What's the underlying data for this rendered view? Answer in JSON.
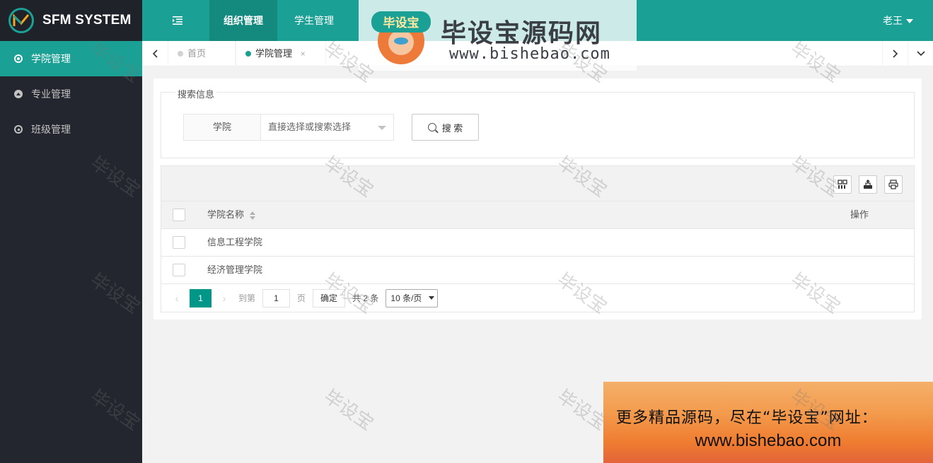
{
  "app": {
    "title": "SFM SYSTEM"
  },
  "sidebar": {
    "items": [
      {
        "label": "学院管理",
        "icon": "circle-dot-icon",
        "active": true
      },
      {
        "label": "专业管理",
        "icon": "triangle-circle-icon",
        "active": false
      },
      {
        "label": "班级管理",
        "icon": "compass-icon",
        "active": false
      }
    ]
  },
  "header": {
    "tabs": [
      {
        "label": "组织管理",
        "active": true
      },
      {
        "label": "学生管理",
        "active": false
      }
    ],
    "user": "老王"
  },
  "tabbar": {
    "tabs": [
      {
        "label": "首页",
        "active": false
      },
      {
        "label": "学院管理",
        "active": true,
        "close": "×"
      }
    ]
  },
  "search": {
    "legend": "搜索信息",
    "field_label": "学院",
    "select_placeholder": "直接选择或搜索选择",
    "button": "搜 索"
  },
  "table": {
    "columns": [
      "学院名称",
      "操作"
    ],
    "rows": [
      {
        "name": "信息工程学院"
      },
      {
        "name": "经济管理学院"
      }
    ]
  },
  "pager": {
    "current": "1",
    "goto_prefix": "到第",
    "goto_value": "1",
    "goto_suffix": "页",
    "confirm": "确定",
    "total": "共 2 条",
    "page_size": "10 条/页"
  },
  "watermark": {
    "site_name": "毕设宝源码网",
    "site_url": "www.bishebao.com",
    "logo_text": "毕设宝",
    "tile_text": "毕设宝",
    "promo_line1": "更多精品源码，尽在“毕设宝”网址：",
    "promo_line2": "www.bishebao.com"
  },
  "colors": {
    "accent": "#1aa094",
    "sidebar_bg": "#23262e",
    "pager_current": "#009688"
  }
}
